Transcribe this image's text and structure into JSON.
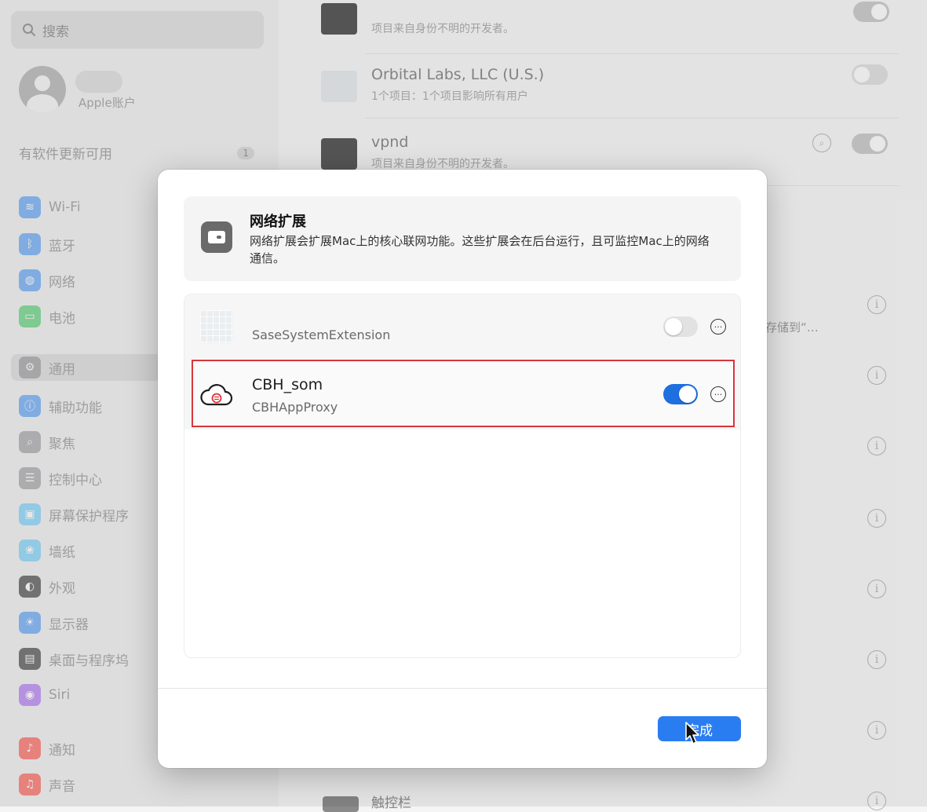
{
  "sidebar": {
    "search_placeholder": "搜索",
    "account_label": "Apple账户",
    "updates_label": "有软件更新可用",
    "updates_count": "1",
    "items": [
      {
        "label": "Wi-Fi",
        "icon": "wifi-icon",
        "color": "#3a8ef6"
      },
      {
        "label": "蓝牙",
        "icon": "bluetooth-icon",
        "color": "#3a8ef6"
      },
      {
        "label": "网络",
        "icon": "globe-icon",
        "color": "#3a8ef6"
      },
      {
        "label": "电池",
        "icon": "battery-icon",
        "color": "#34c759"
      },
      {
        "label": "通用",
        "icon": "gear-icon",
        "color": "#8e8e93"
      },
      {
        "label": "辅助功能",
        "icon": "accessibility-icon",
        "color": "#3a8ef6"
      },
      {
        "label": "聚焦",
        "icon": "spotlight-icon",
        "color": "#8e8e93"
      },
      {
        "label": "控制中心",
        "icon": "control-center-icon",
        "color": "#8e8e93"
      },
      {
        "label": "屏幕保护程序",
        "icon": "screensaver-icon",
        "color": "#5ac8fa"
      },
      {
        "label": "墙纸",
        "icon": "wallpaper-icon",
        "color": "#5ac8fa"
      },
      {
        "label": "外观",
        "icon": "appearance-icon",
        "color": "#1d1d1f"
      },
      {
        "label": "显示器",
        "icon": "display-icon",
        "color": "#3a8ef6"
      },
      {
        "label": "桌面与程序坞",
        "icon": "dock-icon",
        "color": "#1d1d1f"
      },
      {
        "label": "Siri",
        "icon": "siri-icon",
        "color": "#a05cf0"
      },
      {
        "label": "通知",
        "icon": "bell-icon",
        "color": "#ff3b30"
      },
      {
        "label": "声音",
        "icon": "speaker-icon",
        "color": "#ff3b30"
      }
    ]
  },
  "background_list": {
    "rows": [
      {
        "title": "",
        "subtitle": "项目来自身份不明的开发者。"
      },
      {
        "title": "Orbital Labs, LLC (U.S.)",
        "subtitle": "1个项目：1个项目影响所有用户"
      },
      {
        "title": "vpnd",
        "subtitle": "项目来自身份不明的开发者。"
      }
    ],
    "storage_text": "存储到“…",
    "touchbar_label": "触控栏"
  },
  "dialog": {
    "title": "网络扩展",
    "description": "网络扩展会扩展Mac上的核心联网功能。这些扩展会在后台运行，且可监控Mac上的网络通信。",
    "extensions": [
      {
        "name": "",
        "subtitle": "SaseSystemExtension",
        "enabled": false
      },
      {
        "name": "CBH_som",
        "subtitle": "CBHAppProxy",
        "enabled": true
      }
    ],
    "done_label": "完成"
  },
  "colors": {
    "accent": "#2a7df1",
    "highlight_border": "#d9343c"
  }
}
